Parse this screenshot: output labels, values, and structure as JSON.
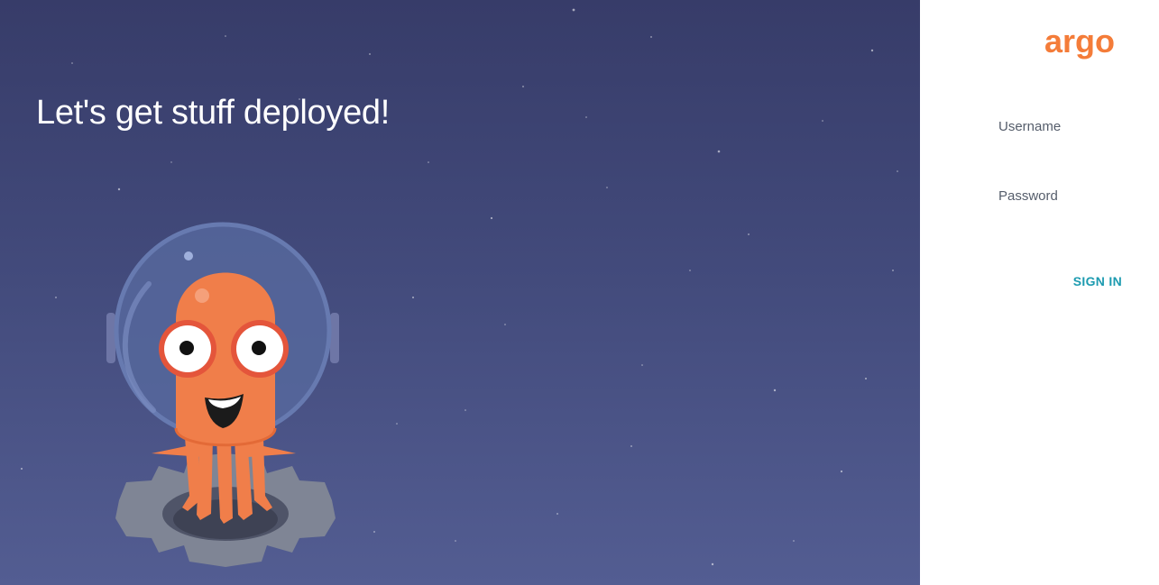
{
  "hero": {
    "title": "Let's get stuff deployed!",
    "mascot_icon": "argo-octopus-astronaut-icon",
    "background_color": "#414879"
  },
  "login": {
    "logo_text": "argo",
    "logo_color": "#f47c39",
    "username": {
      "label": "Username",
      "value": ""
    },
    "password": {
      "label": "Password",
      "value": ""
    },
    "signin_label": "SIGN IN",
    "accent_color": "#1d9bb0"
  }
}
